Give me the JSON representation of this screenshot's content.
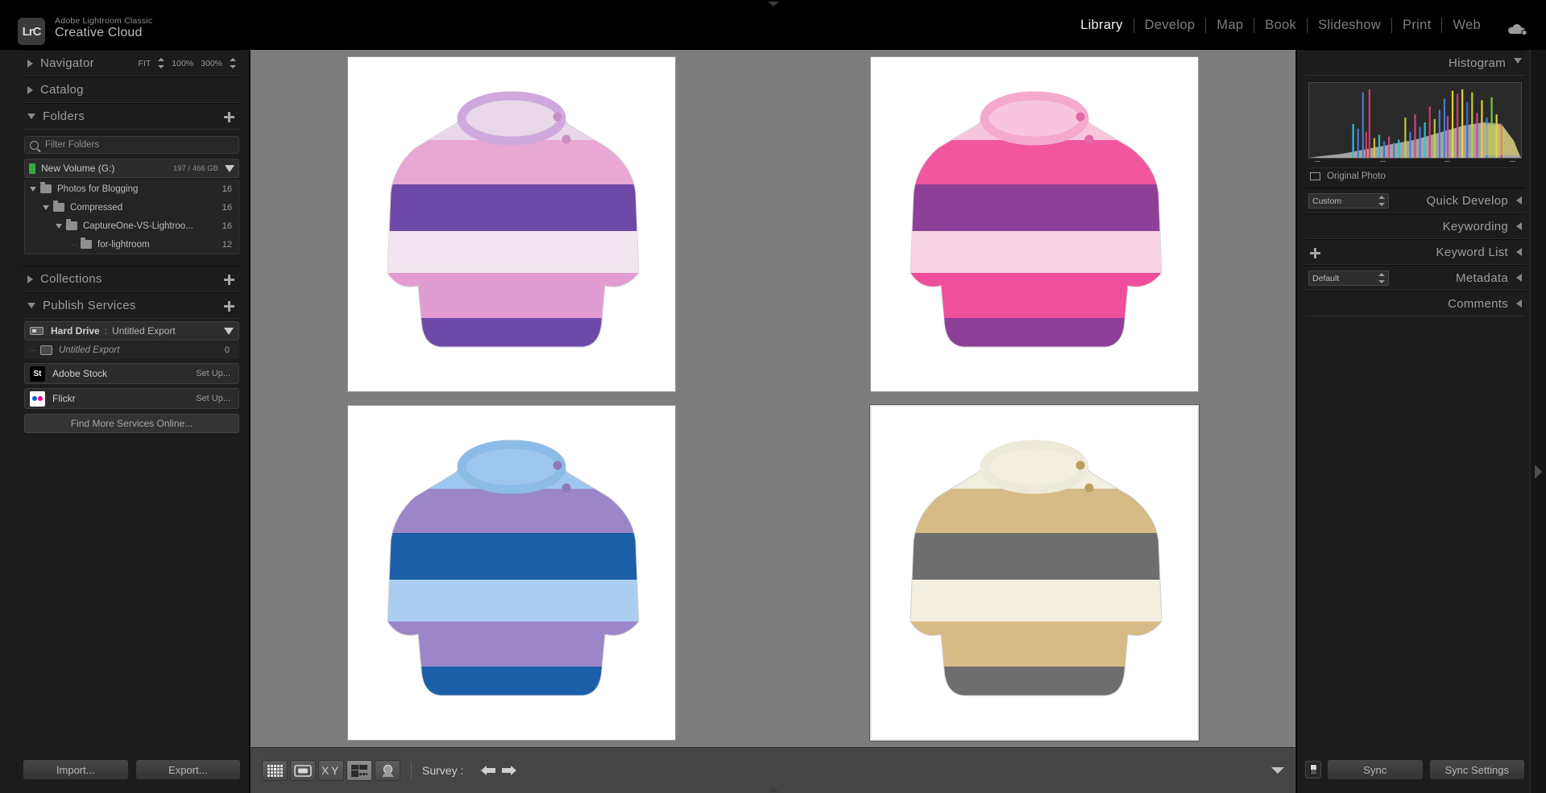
{
  "app": {
    "logo_text": "LrC",
    "brand_small": "Adobe Lightroom Classic",
    "brand_big": "Creative Cloud"
  },
  "modules": [
    {
      "label": "Library",
      "active": true
    },
    {
      "label": "Develop",
      "active": false
    },
    {
      "label": "Map",
      "active": false
    },
    {
      "label": "Book",
      "active": false
    },
    {
      "label": "Slideshow",
      "active": false
    },
    {
      "label": "Print",
      "active": false
    },
    {
      "label": "Web",
      "active": false
    }
  ],
  "left_panel": {
    "navigator": {
      "title": "Navigator",
      "fit": "FIT",
      "zoom_100": "100%",
      "zoom_300": "300%"
    },
    "catalog": {
      "title": "Catalog"
    },
    "folders": {
      "title": "Folders",
      "filter_placeholder": "Filter Folders",
      "volume": {
        "name": "New Volume (G:)",
        "size": "197 / 466 GB"
      },
      "tree": [
        {
          "label": "Photos for Blogging",
          "count": "16",
          "depth": 0,
          "expanded": true
        },
        {
          "label": "Compressed",
          "count": "16",
          "depth": 1,
          "expanded": true
        },
        {
          "label": "CaptureOne-VS-Lightroo...",
          "count": "16",
          "depth": 2,
          "expanded": true
        },
        {
          "label": "for-lightroom",
          "count": "12",
          "depth": 3,
          "expanded": false
        }
      ]
    },
    "collections": {
      "title": "Collections"
    },
    "publish_services": {
      "title": "Publish Services",
      "hard_drive": {
        "name": "Hard Drive",
        "separator": ":",
        "target": "Untitled Export"
      },
      "hard_drive_child": {
        "label": "Untitled Export",
        "count": "0"
      },
      "services": [
        {
          "name": "Adobe Stock",
          "action": "Set Up...",
          "icon": "adobe-stock-icon"
        },
        {
          "name": "Flickr",
          "action": "Set Up...",
          "icon": "flickr-icon"
        }
      ],
      "find_more": "Find More Services Online..."
    },
    "buttons": {
      "import": "Import...",
      "export": "Export..."
    }
  },
  "right_panel": {
    "histogram": {
      "title": "Histogram",
      "original_photo": "Original Photo"
    },
    "quick_develop": {
      "title": "Quick Develop",
      "preset": "Custom"
    },
    "keywording": {
      "title": "Keywording"
    },
    "keyword_list": {
      "title": "Keyword List"
    },
    "metadata": {
      "title": "Metadata",
      "preset": "Default"
    },
    "comments": {
      "title": "Comments"
    },
    "buttons": {
      "sync": "Sync",
      "sync_settings": "Sync Settings"
    }
  },
  "toolbar": {
    "view_modes": [
      {
        "name": "grid-view-icon",
        "active": false
      },
      {
        "name": "loupe-view-icon",
        "active": false
      },
      {
        "name": "compare-view-icon",
        "active": false
      },
      {
        "name": "survey-view-icon",
        "active": true
      },
      {
        "name": "people-view-icon",
        "active": false
      }
    ],
    "survey_label": "Survey :",
    "prev_label": "previous-arrow-icon",
    "next_label": "next-arrow-icon"
  },
  "grid": {
    "photos": [
      {
        "id": "sweater-purple-pink",
        "selected": false,
        "stripes": [
          "#e8d8ea",
          "#e8a7d4",
          "#6d4aa8",
          "#f1e6ef",
          "#e19cd2",
          "#6d4aa8"
        ],
        "neck": "#cfa9dd",
        "cuff": "#7a4fb0",
        "button": "#c98ec4"
      },
      {
        "id": "sweater-hot-pink",
        "selected": false,
        "stripes": [
          "#f7c6dd",
          "#f2569f",
          "#8e3f97",
          "#f7d2e3",
          "#ef4e9b",
          "#8e3f97"
        ],
        "neck": "#f5a9cd",
        "cuff": "#8e3f97",
        "button": "#e06aa6"
      },
      {
        "id": "sweater-blue-purple",
        "selected": false,
        "stripes": [
          "#9fc6ee",
          "#9a86c8",
          "#1b5fa8",
          "#aacdf0",
          "#9a86c8",
          "#1b5fa8"
        ],
        "neck": "#8cbbe8",
        "cuff": "#1b5fa8",
        "button": "#8d7ab8"
      },
      {
        "id": "sweater-tan-grey",
        "selected": true,
        "stripes": [
          "#f2efdf",
          "#d6bb86",
          "#6e6e6e",
          "#f2efdf",
          "#d6bb86",
          "#6e6e6e"
        ],
        "neck": "#eeead9",
        "cuff": "#6e6e6e",
        "button": "#b99f5e"
      }
    ]
  }
}
